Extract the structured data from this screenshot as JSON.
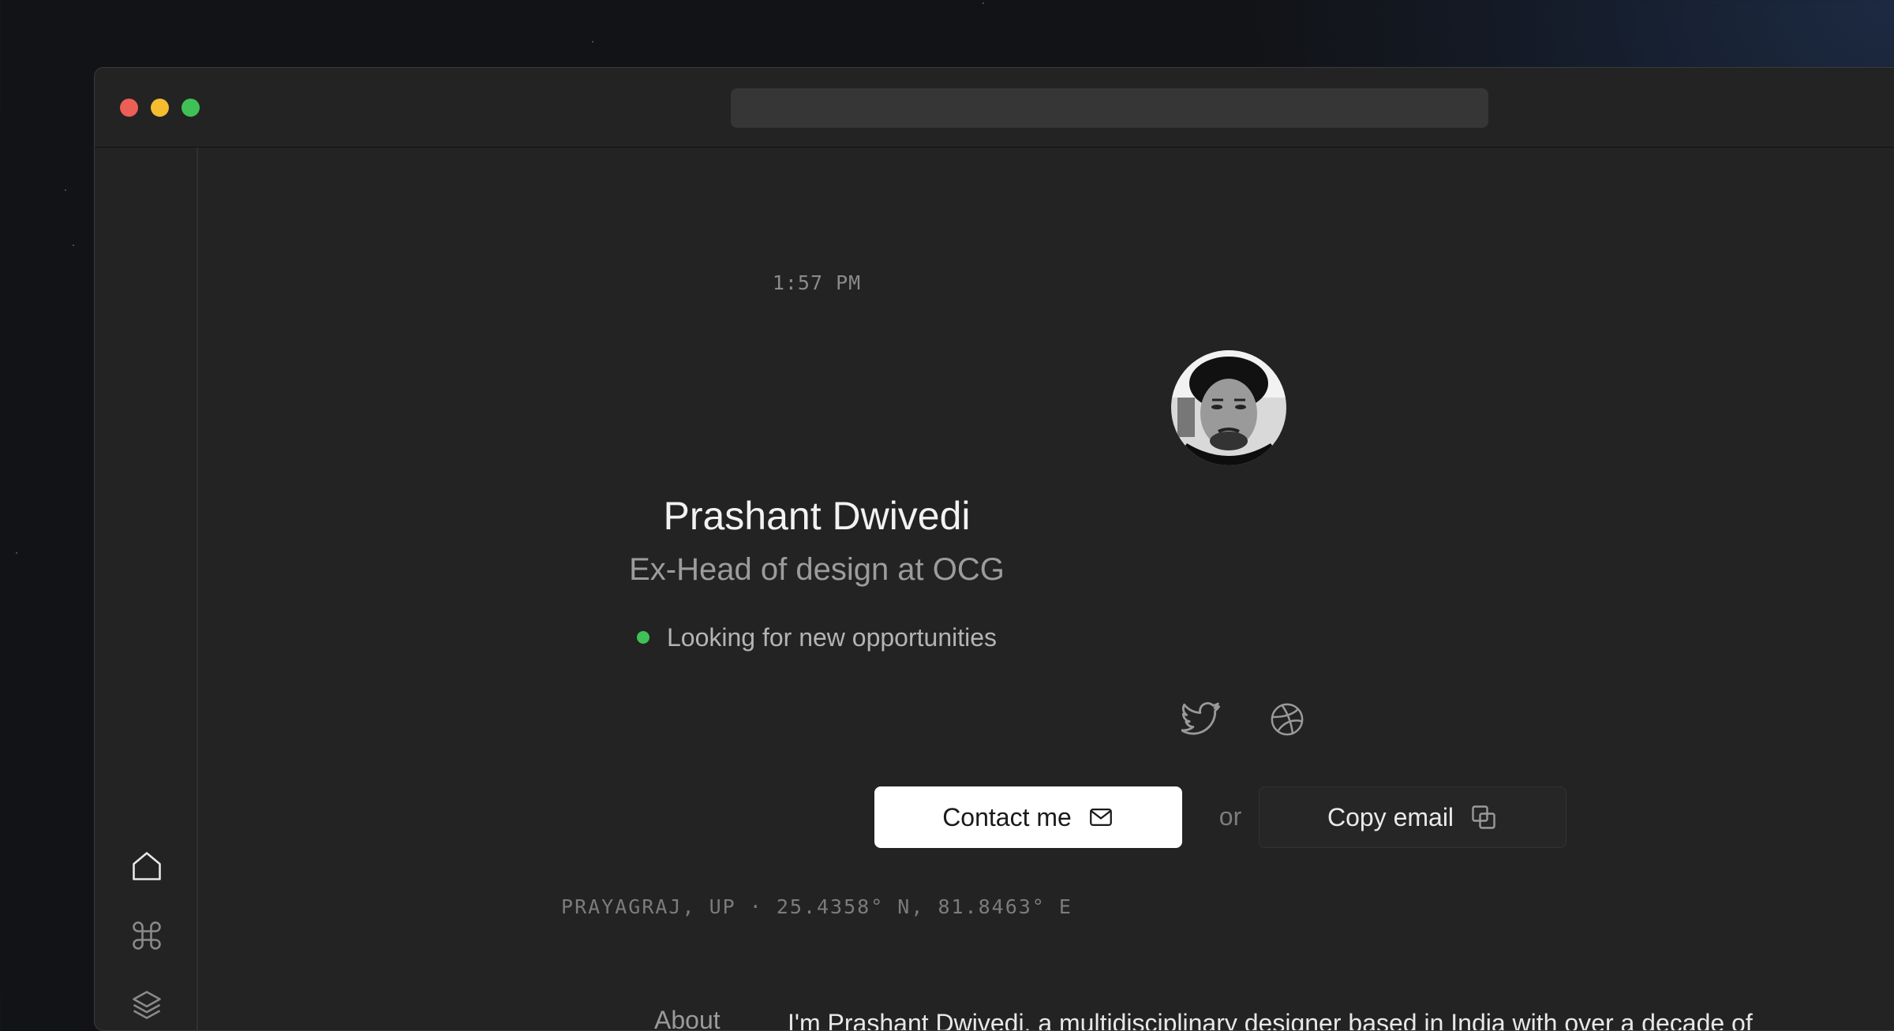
{
  "profile": {
    "time": "1:57 PM",
    "name": "Prashant Dwivedi",
    "role": "Ex-Head of design at OCG",
    "status": "Looking for new opportunities",
    "location": "PRAYAGRAJ, UP · 25.4358° N, 81.8463° E"
  },
  "social": {
    "icons": [
      "twitter-icon",
      "dribbble-icon"
    ]
  },
  "actions": {
    "contact_label": "Contact me",
    "or_label": "or",
    "copy_label": "Copy email"
  },
  "sidebar": {
    "icons": [
      "home-icon",
      "command-icon",
      "layers-icon"
    ]
  },
  "about": {
    "label": "About",
    "text": "I'm Prashant Dwivedi, a multidisciplinary designer based in India with over a decade of experience in UI/UX design."
  },
  "colors": {
    "status": "#3fc157",
    "close": "#ec5f56",
    "minimize": "#f4bd2f",
    "maximize": "#3fc157"
  }
}
